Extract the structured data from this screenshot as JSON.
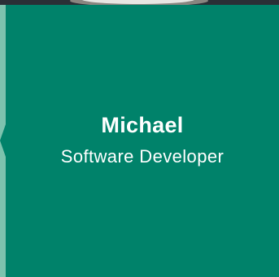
{
  "profile": {
    "name": "Michael",
    "title": "Software Developer"
  },
  "colors": {
    "panel": "#00826a",
    "accent_edge": "#7cc3ae",
    "text": "#ffffff"
  }
}
